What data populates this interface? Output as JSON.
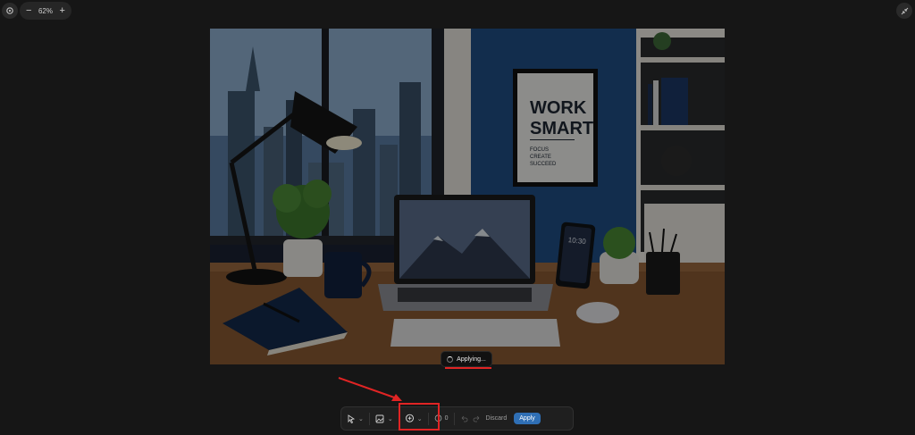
{
  "top_left": {
    "settings_icon": "gear-icon",
    "zoom": {
      "minus": "−",
      "value": "62%",
      "plus": "+"
    }
  },
  "top_right": {
    "icon": "collapse-icon"
  },
  "canvas": {
    "poster_lines": [
      "WORK",
      "SMART"
    ],
    "poster_sub": [
      "FOCUS",
      "CREATE",
      "SUCCEED"
    ],
    "phone_time": "10:30"
  },
  "status": {
    "text": "Applying..."
  },
  "toolbar": {
    "comment_count": "0",
    "discard_label": "Discard",
    "apply_label": "Apply",
    "colors": {
      "apply": "#2f6fb5",
      "annotation": "#e02424"
    }
  }
}
